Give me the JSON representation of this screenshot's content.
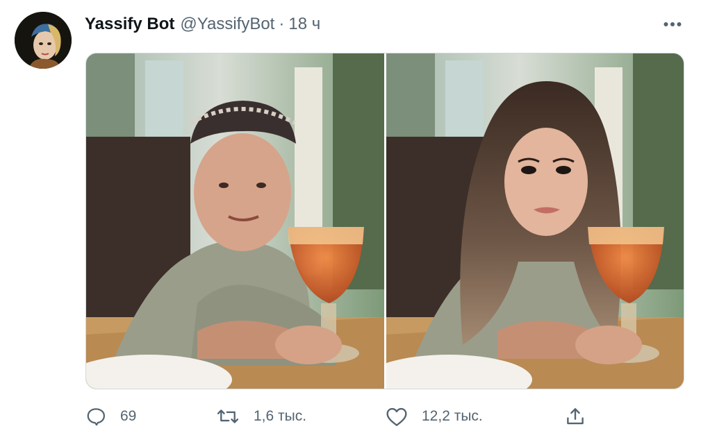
{
  "tweet": {
    "author_name": "Yassify Bot",
    "author_handle": "@YassifyBot",
    "separator": "·",
    "time": "18 ч",
    "avatar_icon": "avatar-portrait",
    "more_icon": "more-dots-icon"
  },
  "media": {
    "images": [
      {
        "name": "original-photo"
      },
      {
        "name": "yassified-photo"
      }
    ]
  },
  "actions": {
    "reply_count": "69",
    "retweet_count": "1,6 тыс.",
    "like_count": "12,2 тыс.",
    "icons": [
      "reply-icon",
      "retweet-icon",
      "like-icon",
      "share-icon"
    ]
  },
  "colors": {
    "text_primary": "#0f1419",
    "text_secondary": "#536471",
    "border": "#cfd9de"
  }
}
